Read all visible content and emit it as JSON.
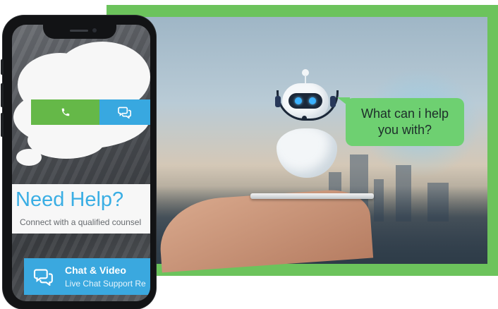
{
  "hero": {
    "speech_bubble": {
      "line1": "What can i help",
      "line2": "you with?"
    },
    "frame_color": "#6cc35c",
    "bubble_color": "#6ed071"
  },
  "phone_app": {
    "contact_bar": {
      "call_icon": "phone-icon",
      "chat_icon": "chat-bubbles-icon",
      "call_color": "#65b848",
      "chat_color": "#38a8e0"
    },
    "help": {
      "title": "Need Help?",
      "subtitle": "Connect with a qualified counsel"
    },
    "chat_button": {
      "icon": "chat-bubbles-icon",
      "title": "Chat & Video",
      "subtitle": "Live Chat Support Re"
    },
    "accent_color": "#3aaee4"
  }
}
